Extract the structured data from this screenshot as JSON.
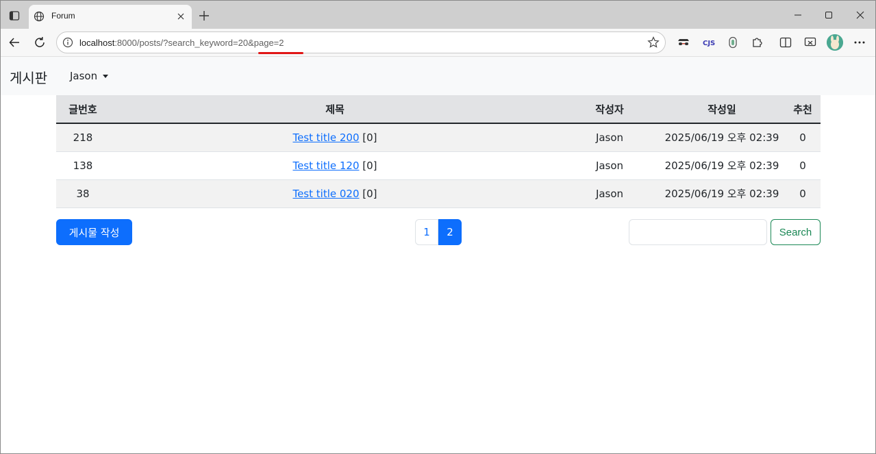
{
  "browser": {
    "tab_title": "Forum",
    "url_host": "localhost",
    "url_rest": ":8000/posts/?search_keyword=20&page=2",
    "colors": {
      "annotation_underline": "#e01616"
    },
    "extensions": [
      "incognito-mask-icon",
      "cjs-icon",
      "shield-icon",
      "puzzle-icon",
      "split-screen-icon",
      "screenshot-icon"
    ]
  },
  "navbar": {
    "brand": "게시판",
    "user": "Jason"
  },
  "table": {
    "headers": [
      "글번호",
      "제목",
      "작성자",
      "작성일",
      "추천"
    ],
    "rows": [
      {
        "num": "218",
        "title": "Test title 200",
        "comments": "[0]",
        "author": "Jason",
        "date": "2025/06/19 오후 02:39",
        "recommend": "0"
      },
      {
        "num": "138",
        "title": "Test title 120",
        "comments": "[0]",
        "author": "Jason",
        "date": "2025/06/19 오후 02:39",
        "recommend": "0"
      },
      {
        "num": "38",
        "title": "Test title 020",
        "comments": "[0]",
        "author": "Jason",
        "date": "2025/06/19 오후 02:39",
        "recommend": "0"
      }
    ]
  },
  "actions": {
    "write_label": "게시물 작성",
    "pages": [
      "1",
      "2"
    ],
    "active_page": "2",
    "search_value": "",
    "search_label": "Search"
  },
  "colors": {
    "primary": "#0d6efd",
    "success": "#198754",
    "header_bg": "#e2e3e5"
  }
}
